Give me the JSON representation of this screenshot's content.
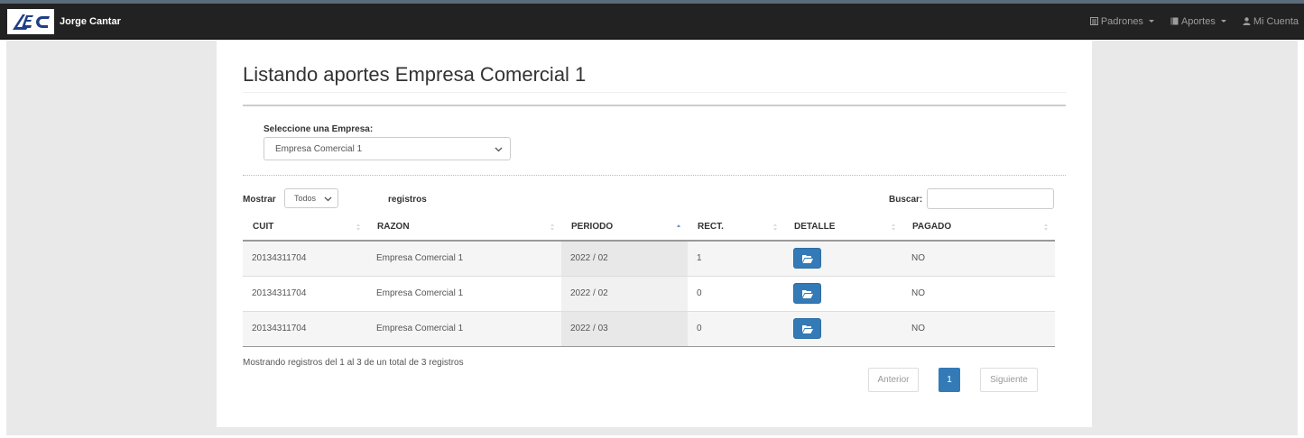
{
  "navbar": {
    "logo_text": "SEC",
    "user_name": "Jorge Cantar",
    "items": [
      {
        "label": "Padrones",
        "icon": "list-icon"
      },
      {
        "label": "Aportes",
        "icon": "book-icon"
      },
      {
        "label": "Mi Cuenta",
        "icon": "user-icon"
      }
    ]
  },
  "page": {
    "title": "Listando aportes Empresa Comercial 1"
  },
  "empresa": {
    "label": "Seleccione una Empresa:",
    "selected": "Empresa Comercial 1"
  },
  "table_controls": {
    "show_label": "Mostrar",
    "show_value": "Todos",
    "records_label": "registros",
    "search_label": "Buscar:",
    "search_value": ""
  },
  "table": {
    "columns": [
      "CUIT",
      "RAZON",
      "PERIODO",
      "RECT.",
      "DETALLE",
      "PAGADO"
    ],
    "sorted_column": "PERIODO",
    "rows": [
      {
        "cuit": "20134311704",
        "razon": "Empresa Comercial 1",
        "periodo": "2022 / 02",
        "rect": "1",
        "pagado": "NO"
      },
      {
        "cuit": "20134311704",
        "razon": "Empresa Comercial 1",
        "periodo": "2022 / 02",
        "rect": "0",
        "pagado": "NO"
      },
      {
        "cuit": "20134311704",
        "razon": "Empresa Comercial 1",
        "periodo": "2022 / 03",
        "rect": "0",
        "pagado": "NO"
      }
    ]
  },
  "footer": {
    "info": "Mostrando registros del 1 al 3 de un total de 3 registros",
    "prev": "Anterior",
    "current_page": "1",
    "next": "Siguiente"
  },
  "colors": {
    "navbar": "#222222",
    "primary": "#337ab7",
    "page_bg": "#e9e9e9"
  }
}
